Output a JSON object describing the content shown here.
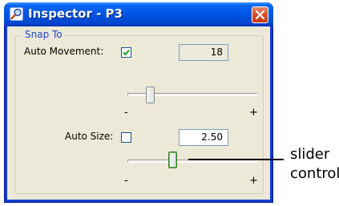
{
  "window": {
    "title": "Inspector - P3",
    "close_label": "✕"
  },
  "snap_group": {
    "legend": "Snap To",
    "auto_movement": {
      "label": "Auto Movement:",
      "checked": true,
      "value": "18",
      "slider": {
        "min_label": "-",
        "max_label": "+"
      }
    },
    "auto_size": {
      "label": "Auto Size:",
      "checked": false,
      "value": "2.50",
      "slider": {
        "min_label": "-",
        "max_label": "+"
      }
    }
  },
  "callout": {
    "line1": "slider",
    "line2": "control"
  }
}
